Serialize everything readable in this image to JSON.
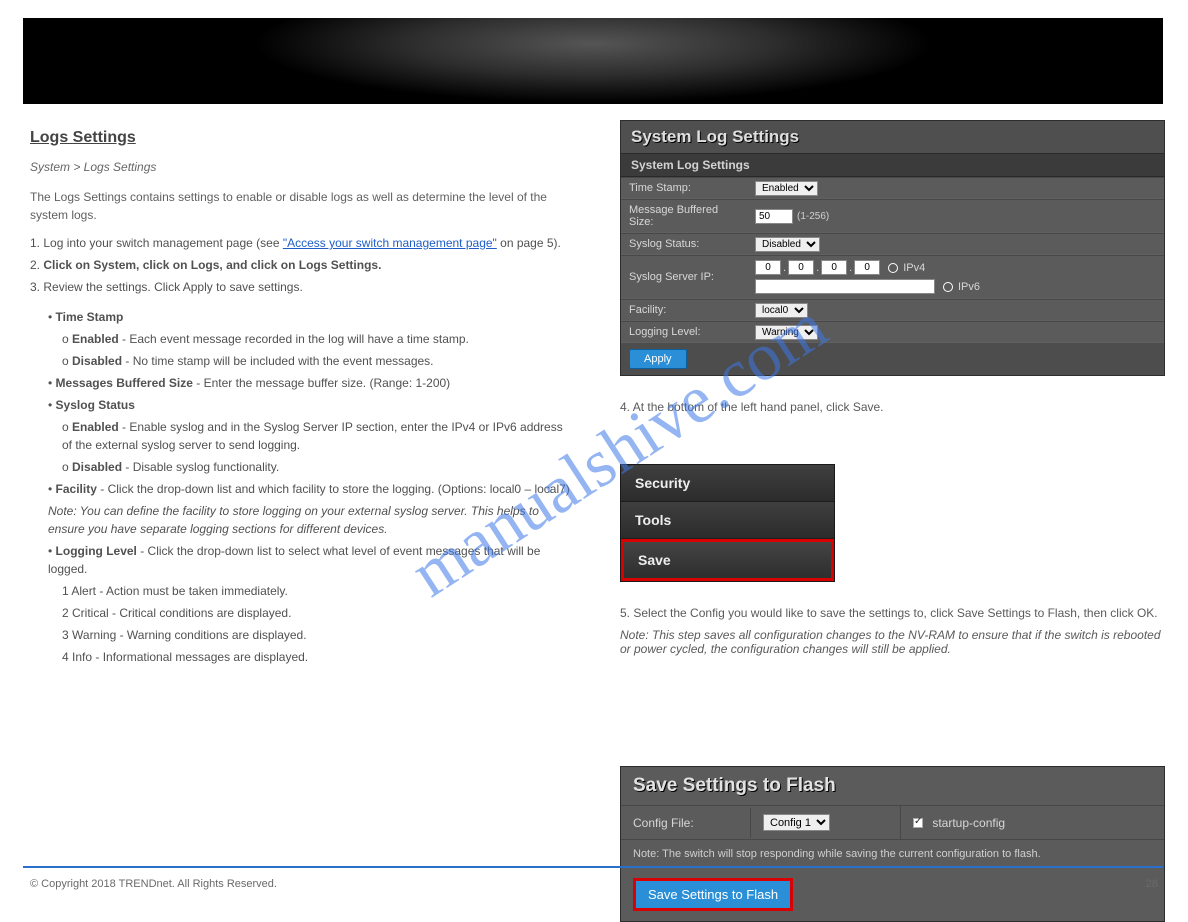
{
  "header": {
    "page_title_left": ""
  },
  "left": {
    "section_title": "Logs Settings",
    "section_path": "System > Logs Settings",
    "body1": "The Logs Settings contains settings to enable or disable logs as well as determine the level of the system logs.",
    "step_intro": "",
    "step1_num": "1.",
    "step1": "Log into your switch management page (see ",
    "step1_link": "\"Access your switch management page\"",
    "step1_after": " on page 5).",
    "step2_num": "2.",
    "step2": "Click on System, click on Logs, and click on Logs Settings.",
    "step3_num": "3.",
    "step3": "Review the settings. Click Apply to save settings.",
    "field1_label": "Time Stamp",
    "field1_enabled": "Enabled",
    "field1_enabled_desc": " - Each event message recorded in the log will have a time stamp.",
    "field1_disabled": "Disabled",
    "field1_disabled_desc": " - No time stamp will be included with the event messages.",
    "field2_label": "Messages Buffered Size",
    "field2_desc": " - Enter the message buffer size. (Range: 1-200)",
    "field3_label": "Syslog Status",
    "field3_enabled_desc": " - Enable syslog and in the Syslog Server IP section, enter the IPv4 or IPv6 address of the external syslog server to send logging.",
    "field3_disabled_desc": " - Disable syslog functionality.",
    "field4_label": "Facility",
    "field4_desc": " - Click the drop-down list and which facility to store the logging. (Options: local0 – local7)",
    "note": "Note: You can define the facility to store logging on your external syslog server. This helps to ensure you have separate logging sections for different devices.",
    "field5_label": "Logging Level",
    "field5_desc": " - Click the drop-down list to select what level of event messages that will be logged.",
    "lvl1": "1 Alert - Action must be taken immediately.",
    "lvl2": "2 Critical - Critical conditions are displayed.",
    "lvl3": "3 Warning - Warning conditions are displayed.",
    "lvl4": "4 Info - Informational messages are displayed."
  },
  "panel1": {
    "title": "System Log Settings",
    "subtitle": "System Log Settings",
    "time_stamp_label": "Time Stamp:",
    "time_stamp_value": "Enabled",
    "buffer_label": "Message Buffered Size:",
    "buffer_value": "50",
    "buffer_range": "(1-256)",
    "syslog_status_label": "Syslog Status:",
    "syslog_status_value": "Disabled",
    "syslog_ip_label": "Syslog Server IP:",
    "ip1": "0",
    "ip2": "0",
    "ip3": "0",
    "ip4": "0",
    "ipv4_label": "IPv4",
    "ipv6_label": "IPv6",
    "facility_label": "Facility:",
    "facility_value": "local0",
    "logging_label": "Logging Level:",
    "logging_value": "Warning",
    "apply_label": "Apply"
  },
  "nav": {
    "item1": "Security",
    "item2": "Tools",
    "item3": "Save"
  },
  "right_text": {
    "step4_num": "4.",
    "step4": "At the bottom of the left hand panel, click Save.",
    "step5_num": "5.",
    "step5": "Select the Config you would like to save the settings to, click Save Settings to Flash, then click OK.",
    "step5_note": "Note: This step saves all configuration changes to the NV-RAM to ensure that if the switch is rebooted or power cycled, the configuration changes will still be applied."
  },
  "flash": {
    "title": "Save Settings to Flash",
    "config_label": "Config File:",
    "config_value": "Config 1",
    "startup_label": "startup-config",
    "note": "Note: The switch will stop responding while saving the current configuration to flash.",
    "button": "Save Settings to Flash"
  },
  "footer": {
    "copyright": "© Copyright 2018 TRENDnet. All Rights Reserved.",
    "page": "28"
  },
  "watermark": "manualshive.com"
}
